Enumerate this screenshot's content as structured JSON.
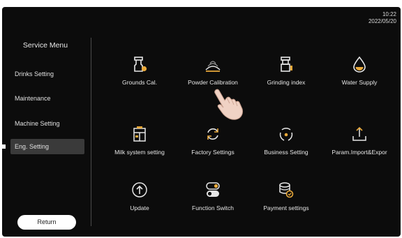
{
  "status": {
    "time": "10:22",
    "date": "2022/05/20"
  },
  "sidebar": {
    "title": "Service Menu",
    "items": [
      {
        "label": "Drinks Setting"
      },
      {
        "label": "Maintenance"
      },
      {
        "label": "Machine Setting"
      },
      {
        "label": "Eng. Setting",
        "active": true
      }
    ],
    "return_label": "Return"
  },
  "main": {
    "tiles": [
      {
        "label": "Grounds Cal.",
        "icon": "grounds-container-icon"
      },
      {
        "label": "Powder Calibration",
        "icon": "powder-icon"
      },
      {
        "label": "Grinding index",
        "icon": "grinder-icon"
      },
      {
        "label": "Water Supply",
        "icon": "water-drop-icon"
      },
      {
        "label": "Milk system setting",
        "icon": "milk-system-icon"
      },
      {
        "label": "Factory Settings",
        "icon": "refresh-icon"
      },
      {
        "label": "Business Setting",
        "icon": "business-cycle-icon"
      },
      {
        "label": "Param.Import&Expor",
        "icon": "import-export-icon"
      },
      {
        "label": "Update",
        "icon": "update-arrow-icon"
      },
      {
        "label": "Function Switch",
        "icon": "toggle-switch-icon"
      },
      {
        "label": "Payment settings",
        "icon": "payment-coins-icon"
      }
    ]
  },
  "colors": {
    "background": "#0c0c0c",
    "accent": "#e9a93a",
    "text": "#e6e6e6"
  }
}
